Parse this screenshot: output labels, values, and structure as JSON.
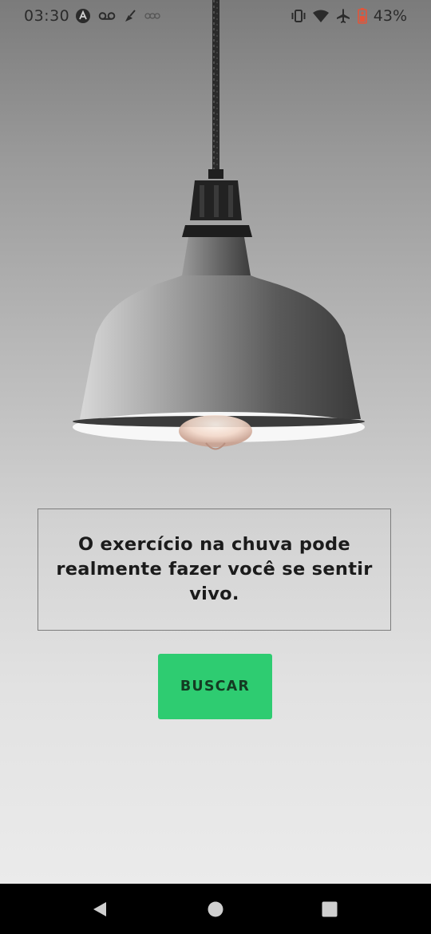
{
  "status_bar": {
    "time": "03:30",
    "battery_percent": "43%",
    "left_icons": [
      "app-a-icon",
      "voicemail-icon",
      "broom-icon",
      "signal-dots-icon"
    ],
    "right_icons": [
      "vibrate-icon",
      "wifi-icon",
      "airplane-icon",
      "battery-icon"
    ],
    "battery_color": "#e2553a"
  },
  "main": {
    "quote": "O exercício na chuva pode realmente fazer você se sentir vivo.",
    "button_label": "BUSCAR",
    "button_color": "#2ecc71",
    "background_image": "pendant-lamp"
  },
  "nav_bar": {
    "items": [
      "back-icon",
      "home-icon",
      "recents-icon"
    ]
  }
}
